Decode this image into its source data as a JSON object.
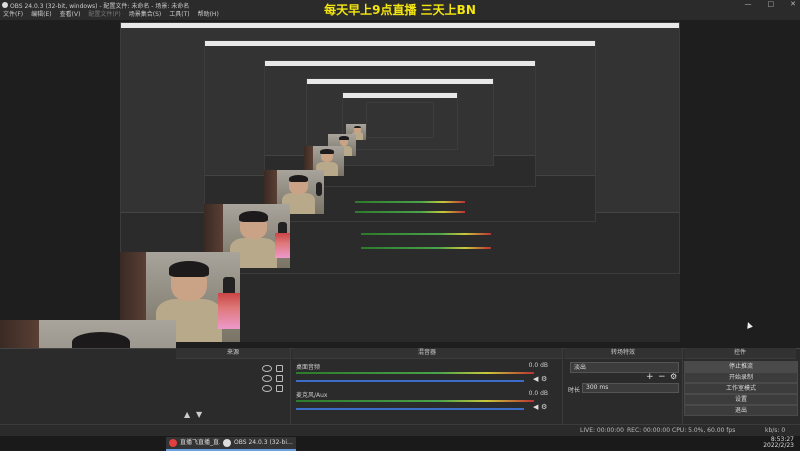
{
  "window": {
    "title": "OBS 24.0.3 (32-bit, windows) - 配置文件: 未命名 - 场景: 未命名",
    "controls": [
      "—",
      "□",
      "✕"
    ]
  },
  "menu": {
    "items": [
      "文件(F)",
      "编辑(E)",
      "查看(V)",
      "配置文件(P)",
      "场景集合(S)",
      "工具(T)",
      "帮助(H)"
    ],
    "disabled_index": 3
  },
  "overlay": {
    "banner": "每天早上9点直播  三天上BN"
  },
  "docks": {
    "scenes_title": "场景",
    "sources_title": "来源",
    "mixer_title": "混音器",
    "transitions_title": "转场特效",
    "controls_title": "控件"
  },
  "sources": {
    "items": []
  },
  "mixer": {
    "channels": [
      {
        "name": "桌面音频",
        "db": "0.0 dB"
      },
      {
        "name": "麦克风/Aux",
        "db": "0.0 dB"
      }
    ]
  },
  "transitions": {
    "selected": "淡出",
    "duration_label": "时长",
    "duration_value": "300 ms",
    "add": "+",
    "remove": "−",
    "config": "⚙"
  },
  "controls": {
    "stop_streaming": "停止推流",
    "start_recording": "开始录制",
    "studio_mode": "工作室模式",
    "settings": "设置",
    "exit": "退出"
  },
  "status": {
    "live": "LIVE: 00:00:00",
    "rec": "REC: 00:00:00",
    "cpu": "CPU: 5.0%, 60.00 fps",
    "kbps": "kb/s: 0"
  },
  "taskbar": {
    "apps": [
      {
        "label": "直播飞直播_直..."
      },
      {
        "label": "OBS 24.0.3 (32-bi..."
      }
    ],
    "time": "8:53:27",
    "date": "2022/2/23"
  },
  "colors": {
    "banner": "#f4e60f",
    "dock_bg": "#2b2b2b",
    "meter_blue": "#3b6cc8"
  }
}
